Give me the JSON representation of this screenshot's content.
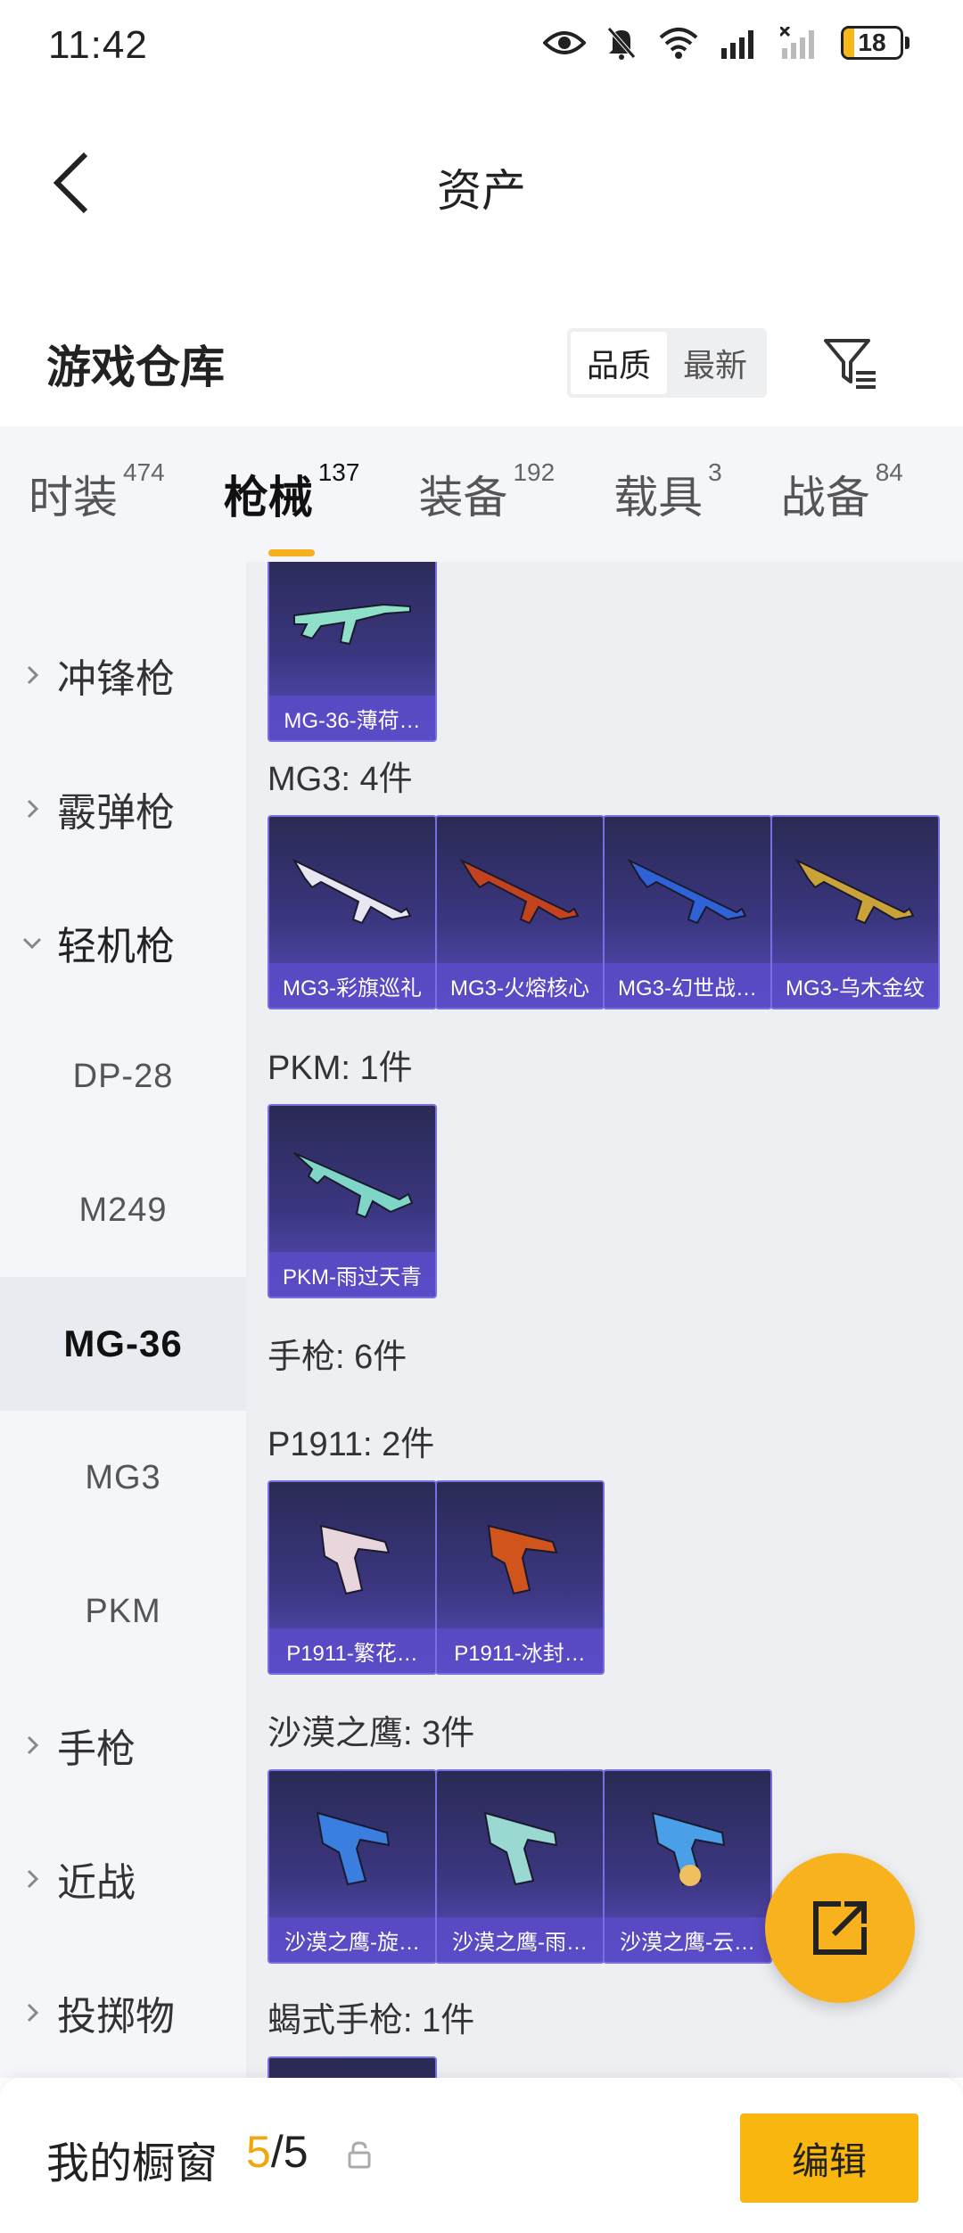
{
  "status_bar": {
    "time": "11:42",
    "battery_level": "18"
  },
  "nav": {
    "title": "资产"
  },
  "warehouse": {
    "title": "游戏仓库",
    "sort_options": [
      "品质",
      "最新"
    ],
    "active_sort": "品质"
  },
  "tabs": [
    {
      "label": "时装",
      "count": "474"
    },
    {
      "label": "枪械",
      "count": "137"
    },
    {
      "label": "装备",
      "count": "192"
    },
    {
      "label": "载具",
      "count": "3"
    },
    {
      "label": "战备",
      "count": "84"
    }
  ],
  "active_tab": "枪械",
  "sidebar": {
    "categories": [
      {
        "label": "冲锋枪"
      },
      {
        "label": "霰弹枪"
      },
      {
        "label": "轻机枪"
      },
      {
        "label": "手枪"
      },
      {
        "label": "近战"
      },
      {
        "label": "投掷物"
      }
    ],
    "subitems": [
      {
        "label": "DP-28"
      },
      {
        "label": "M249"
      },
      {
        "label": "MG-36"
      },
      {
        "label": "MG3"
      },
      {
        "label": "PKM"
      }
    ],
    "selected_subitem": "MG-36"
  },
  "content": {
    "groups": [
      {
        "title": "",
        "items": [
          {
            "name": "MG-36-薄荷…",
            "color": "#8fe0c8"
          }
        ]
      },
      {
        "title": "MG3: 4件",
        "items": [
          {
            "name": "MG3-彩旗巡礼",
            "color": "#e8e6f0"
          },
          {
            "name": "MG3-火熔核心",
            "color": "#c2431e"
          },
          {
            "name": "MG3-幻世战…",
            "color": "#2f62d6"
          },
          {
            "name": "MG3-乌木金纹",
            "color": "#c9a23a"
          }
        ]
      },
      {
        "title": "PKM: 1件",
        "items": [
          {
            "name": "PKM-雨过天青",
            "color": "#7fd6c8"
          }
        ]
      },
      {
        "title": "手枪: 6件",
        "items": []
      },
      {
        "title": "P1911: 2件",
        "items": [
          {
            "name": "P1911-繁花…",
            "color": "#e9d6dc"
          },
          {
            "name": "P1911-冰封…",
            "color": "#d0541c"
          }
        ]
      },
      {
        "title": "沙漠之鹰: 3件",
        "items": [
          {
            "name": "沙漠之鹰-旋…",
            "color": "#3a7fe0"
          },
          {
            "name": "沙漠之鹰-雨…",
            "color": "#9ad8d2"
          },
          {
            "name": "沙漠之鹰-云…",
            "color": "#4aa0e8"
          }
        ]
      },
      {
        "title": "蝎式手枪: 1件",
        "items": []
      }
    ]
  },
  "bottom": {
    "showcase_label": "我的橱窗",
    "showcase_used": "5",
    "showcase_total": "/5",
    "edit_label": "编辑"
  },
  "colors": {
    "accent": "#f6b01f",
    "card_bg": "#3b3680",
    "card_label_bg": "#5a4bc8"
  }
}
